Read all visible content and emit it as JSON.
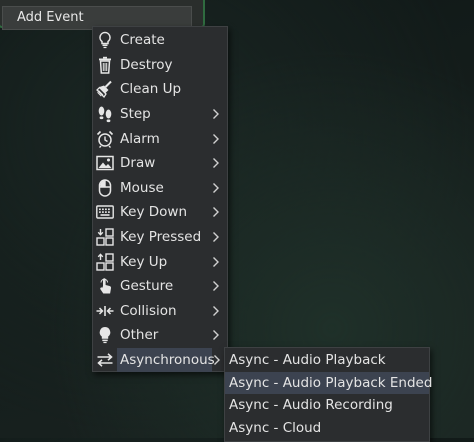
{
  "toolbar": {
    "add_event_label": "Add Event"
  },
  "event_menu": {
    "items": [
      {
        "label": "Create",
        "icon": "bulb-icon",
        "submenu": false
      },
      {
        "label": "Destroy",
        "icon": "trash-icon",
        "submenu": false
      },
      {
        "label": "Clean Up",
        "icon": "broom-icon",
        "submenu": false
      },
      {
        "label": "Step",
        "icon": "footsteps-icon",
        "submenu": true
      },
      {
        "label": "Alarm",
        "icon": "alarm-clock-icon",
        "submenu": true
      },
      {
        "label": "Draw",
        "icon": "picture-icon",
        "submenu": true
      },
      {
        "label": "Mouse",
        "icon": "mouse-icon",
        "submenu": true
      },
      {
        "label": "Key Down",
        "icon": "keyboard-icon",
        "submenu": true
      },
      {
        "label": "Key Pressed",
        "icon": "key-pressed-icon",
        "submenu": true
      },
      {
        "label": "Key Up",
        "icon": "key-up-icon",
        "submenu": true
      },
      {
        "label": "Gesture",
        "icon": "hand-pointer-icon",
        "submenu": true
      },
      {
        "label": "Collision",
        "icon": "collision-icon",
        "submenu": true
      },
      {
        "label": "Other",
        "icon": "bulb-filled-icon",
        "submenu": true
      },
      {
        "label": "Asynchronous",
        "icon": "swap-arrows-icon",
        "submenu": true,
        "selected": true
      }
    ]
  },
  "async_submenu": {
    "items": [
      {
        "label": "Async - Audio Playback"
      },
      {
        "label": "Async - Audio Playback Ended",
        "selected": true
      },
      {
        "label": "Async - Audio Recording"
      },
      {
        "label": "Async - Cloud"
      }
    ]
  },
  "colors": {
    "menu_bg": "#2b2d2f",
    "highlight": "#3c4350",
    "panel_border": "#2f6b3f",
    "text": "#e4e4e4"
  }
}
